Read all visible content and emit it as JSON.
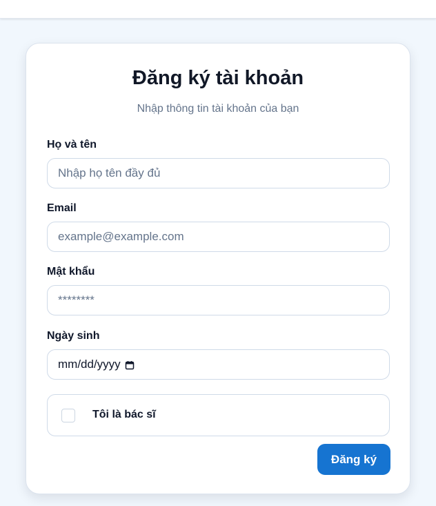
{
  "form": {
    "title": "Đăng ký tài khoản",
    "subtitle": "Nhập thông tin tài khoản của bạn",
    "fields": {
      "full_name": {
        "label": "Họ và tên",
        "placeholder": "Nhập họ tên đầy đủ",
        "value": ""
      },
      "email": {
        "label": "Email",
        "placeholder": "example@example.com",
        "value": ""
      },
      "password": {
        "label": "Mật khẩu",
        "placeholder": "********",
        "value": ""
      },
      "birthdate": {
        "label": "Ngày sinh",
        "placeholder": "mm/dd/yyyy",
        "value": "",
        "icon": "calendar-icon"
      }
    },
    "doctor_checkbox": {
      "label": "Tôi là bác sĩ",
      "checked": false
    },
    "submit_label": "Đăng ký"
  },
  "colors": {
    "page_background": "#f1f7fd",
    "card_background": "#ffffff",
    "primary_button": "#1674d1",
    "text_primary": "#0f172a",
    "text_secondary": "#64748b",
    "input_border": "#cfdae8"
  }
}
